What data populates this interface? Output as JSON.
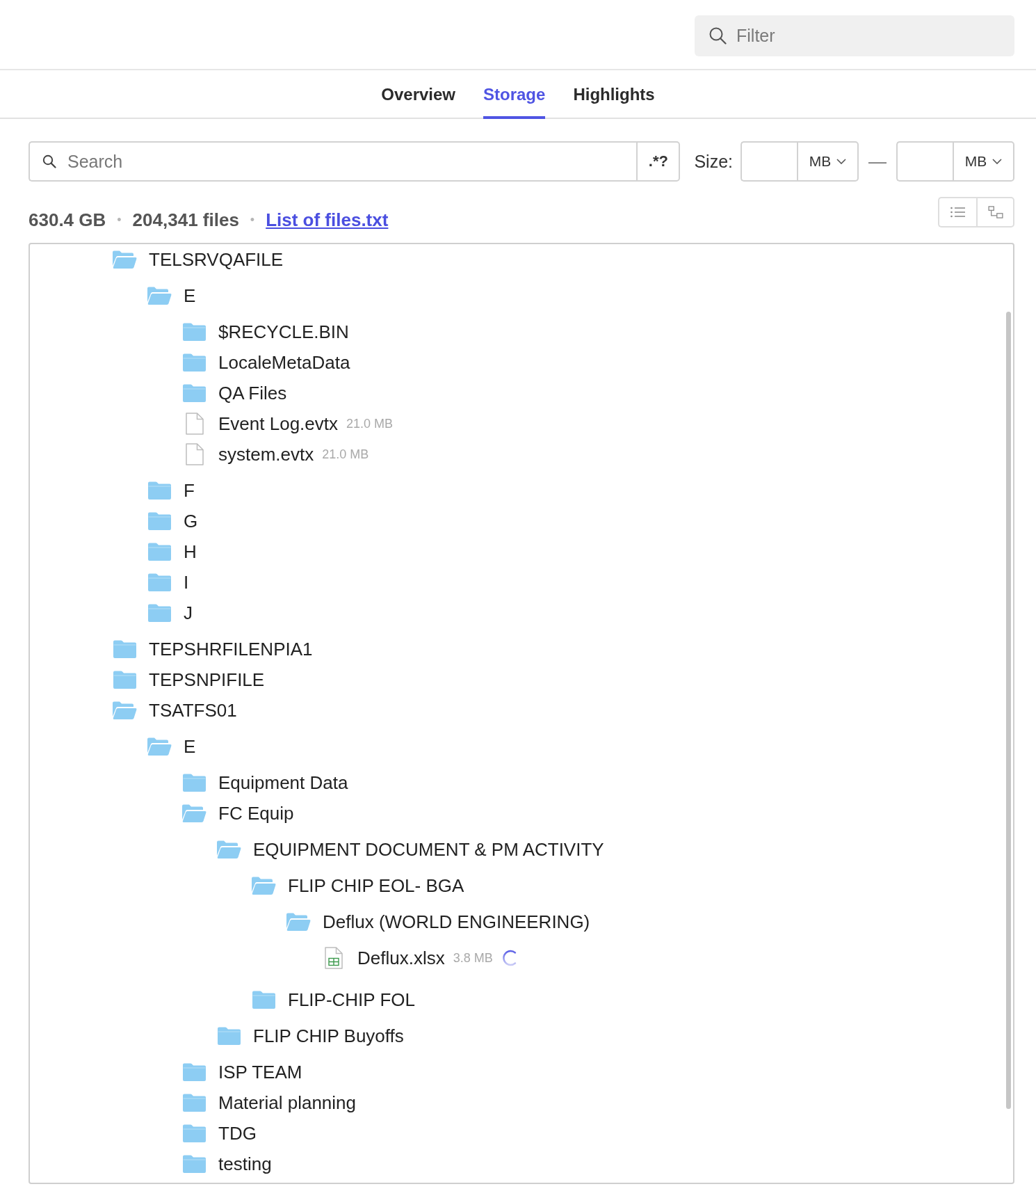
{
  "filter": {
    "placeholder": "Filter"
  },
  "tabs": [
    {
      "label": "Overview",
      "selected": false
    },
    {
      "label": "Storage",
      "selected": true
    },
    {
      "label": "Highlights",
      "selected": false
    }
  ],
  "search": {
    "placeholder": "Search",
    "regex_button": ".*?"
  },
  "size_filter": {
    "label": "Size:",
    "min_unit": "MB",
    "separator": "—",
    "max_unit": "MB"
  },
  "summary": [
    {
      "kind": "stat",
      "text": "630.4 GB"
    },
    {
      "kind": "separator",
      "text": "•"
    },
    {
      "kind": "stat",
      "text": "204,341 files"
    },
    {
      "kind": "separator",
      "text": "•"
    },
    {
      "kind": "link",
      "text": "List of files.txt"
    }
  ],
  "tree": [
    {
      "kind": "folder",
      "name": "TELSRVQAFILE",
      "expanded": true,
      "children": [
        {
          "kind": "folder",
          "name": "E",
          "expanded": true,
          "children": [
            {
              "kind": "folder",
              "name": "$RECYCLE.BIN",
              "expanded": false
            },
            {
              "kind": "folder",
              "name": "LocaleMetaData",
              "expanded": false
            },
            {
              "kind": "folder",
              "name": "QA Files",
              "expanded": false
            },
            {
              "kind": "file",
              "name": "Event Log.evtx",
              "size": "21.0 MB",
              "loading": false
            },
            {
              "kind": "file",
              "name": "system.evtx",
              "size": "21.0 MB",
              "loading": false
            }
          ]
        },
        {
          "kind": "folder",
          "name": "F",
          "expanded": false
        },
        {
          "kind": "folder",
          "name": "G",
          "expanded": false
        },
        {
          "kind": "folder",
          "name": "H",
          "expanded": false
        },
        {
          "kind": "folder",
          "name": "I",
          "expanded": false
        },
        {
          "kind": "folder",
          "name": "J",
          "expanded": false
        }
      ]
    },
    {
      "kind": "folder",
      "name": "TEPSHRFILENPIA1",
      "expanded": false
    },
    {
      "kind": "folder",
      "name": "TEPSNPIFILE",
      "expanded": false
    },
    {
      "kind": "folder",
      "name": "TSATFS01",
      "expanded": true,
      "children": [
        {
          "kind": "folder",
          "name": "E",
          "expanded": true,
          "children": [
            {
              "kind": "folder",
              "name": "Equipment Data",
              "expanded": false
            },
            {
              "kind": "folder",
              "name": "FC Equip",
              "expanded": true,
              "children": [
                {
                  "kind": "folder",
                  "name": "EQUIPMENT DOCUMENT & PM ACTIVITY",
                  "expanded": true,
                  "children": [
                    {
                      "kind": "folder",
                      "name": "FLIP CHIP EOL- BGA",
                      "expanded": true,
                      "children": [
                        {
                          "kind": "folder",
                          "name": "Deflux (WORLD ENGINEERING)",
                          "expanded": true,
                          "children": [
                            {
                              "kind": "spreadsheet",
                              "name": "Deflux.xlsx",
                              "size": "3.8 MB",
                              "loading": true
                            }
                          ]
                        }
                      ]
                    },
                    {
                      "kind": "folder",
                      "name": "FLIP-CHIP FOL",
                      "expanded": false
                    }
                  ]
                },
                {
                  "kind": "folder",
                  "name": "FLIP CHIP Buyoffs",
                  "expanded": false
                }
              ]
            },
            {
              "kind": "folder",
              "name": "ISP TEAM",
              "expanded": false
            },
            {
              "kind": "folder",
              "name": "Material planning",
              "expanded": false
            },
            {
              "kind": "folder",
              "name": "TDG",
              "expanded": false
            },
            {
              "kind": "folder",
              "name": "testing",
              "expanded": false
            }
          ]
        }
      ]
    }
  ]
}
